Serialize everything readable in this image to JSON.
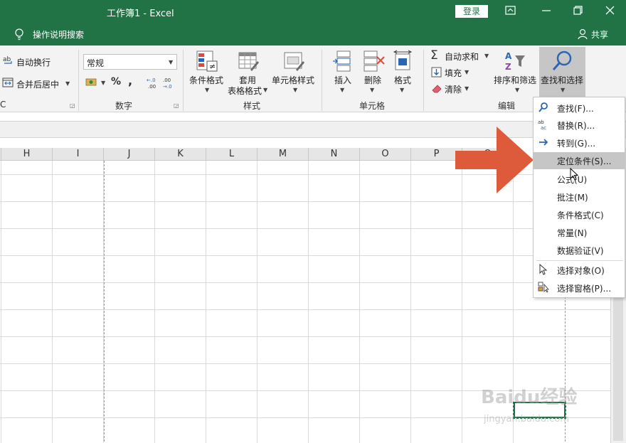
{
  "titlebar": {
    "title": "工作簿1 - Excel",
    "login_label": "登录",
    "accent": "#217346"
  },
  "tellbar": {
    "search_label": "操作说明搜索",
    "share_label": "共享"
  },
  "ribbon": {
    "wrap_text": "自动换行",
    "merge_center": "合并后居中",
    "number_format": "常规",
    "percent": "%",
    "comma": ",",
    "dec_increase": "←.0 .00",
    "dec_decrease": ".00 →.0",
    "group_number": "数字",
    "cond_format": "条件格式",
    "table_format_1": "套用",
    "table_format_2": "表格格式",
    "cell_styles": "单元格样式",
    "group_styles": "样式",
    "insert": "插入",
    "delete": "删除",
    "format": "格式",
    "group_cells": "单元格",
    "autosum": "自动求和",
    "fill": "填充",
    "clear": "清除",
    "sort_filter": "排序和筛选",
    "find_select": "查找和选择",
    "group_editing": "编辑",
    "clipped_label": "C"
  },
  "columns": [
    "H",
    "I",
    "J",
    "K",
    "L",
    "M",
    "N",
    "O",
    "P",
    "Q"
  ],
  "menu": {
    "items": [
      {
        "label": "查找(F)...",
        "icon": "search-icon"
      },
      {
        "label": "替换(R)...",
        "icon": "replace-icon"
      },
      {
        "label": "转到(G)...",
        "icon": "arrow-right-icon"
      },
      {
        "label": "定位条件(S)...",
        "icon": ""
      },
      {
        "label": "公式(U)",
        "icon": ""
      },
      {
        "label": "批注(M)",
        "icon": ""
      },
      {
        "label": "条件格式(C)",
        "icon": ""
      },
      {
        "label": "常量(N)",
        "icon": ""
      },
      {
        "label": "数据验证(V)",
        "icon": ""
      },
      {
        "label": "选择对象(O)",
        "icon": "cursor-icon"
      },
      {
        "label": "选择窗格(P)...",
        "icon": "selection-pane-icon"
      }
    ],
    "highlighted_index": 3
  },
  "overlay": {
    "arrow_color": "#dd5a3a",
    "watermark_1": "Baidu经验",
    "watermark_2": "jingyan.baidu.com"
  }
}
